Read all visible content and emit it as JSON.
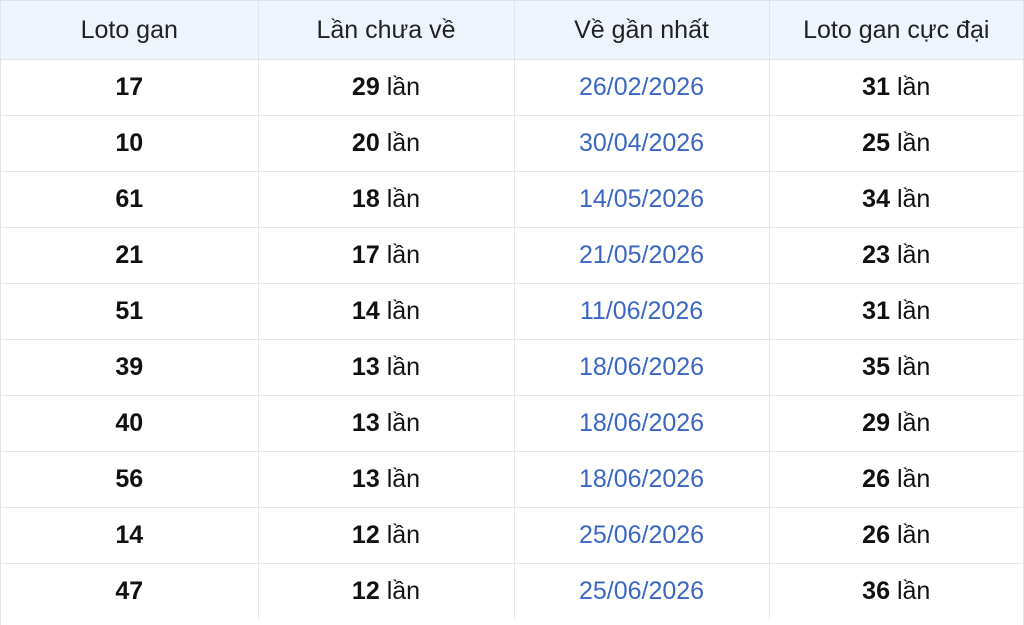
{
  "table": {
    "headers": [
      "Loto gan",
      "Lần chưa về",
      "Về gần nhất",
      "Loto gan cực đại"
    ],
    "unit": "lần",
    "rows": [
      {
        "loto": "17",
        "missed": "29",
        "last_seen": "26/02/2026",
        "max_gan": "31"
      },
      {
        "loto": "10",
        "missed": "20",
        "last_seen": "30/04/2026",
        "max_gan": "25"
      },
      {
        "loto": "61",
        "missed": "18",
        "last_seen": "14/05/2026",
        "max_gan": "34"
      },
      {
        "loto": "21",
        "missed": "17",
        "last_seen": "21/05/2026",
        "max_gan": "23"
      },
      {
        "loto": "51",
        "missed": "14",
        "last_seen": "11/06/2026",
        "max_gan": "31"
      },
      {
        "loto": "39",
        "missed": "13",
        "last_seen": "18/06/2026",
        "max_gan": "35"
      },
      {
        "loto": "40",
        "missed": "13",
        "last_seen": "18/06/2026",
        "max_gan": "29"
      },
      {
        "loto": "56",
        "missed": "13",
        "last_seen": "18/06/2026",
        "max_gan": "26"
      },
      {
        "loto": "14",
        "missed": "12",
        "last_seen": "25/06/2026",
        "max_gan": "26"
      },
      {
        "loto": "47",
        "missed": "12",
        "last_seen": "25/06/2026",
        "max_gan": "36"
      }
    ]
  },
  "colors": {
    "header_bg": "#eef4fb",
    "date_text": "#3a67c4",
    "border": "#dfe3ea"
  }
}
